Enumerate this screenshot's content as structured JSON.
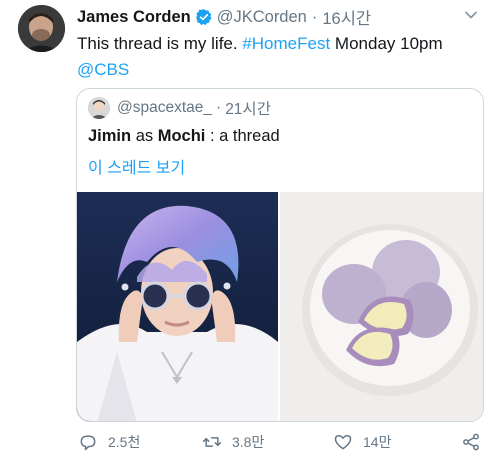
{
  "tweet": {
    "author_name": "James Corden",
    "author_handle": "@JKCorden",
    "separator": "·",
    "time": "16시간",
    "text_main": "This thread is my life. ",
    "hashtag": "#HomeFest",
    "text_after": " Monday 10pm",
    "mention": "@CBS"
  },
  "quote": {
    "handle": "@spacextae_",
    "separator": "·",
    "time": "21시간",
    "subject": "Jimin",
    "word_as": " as ",
    "object": "Mochi",
    "rest": " : a thread",
    "show_thread": "이 스레드 보기"
  },
  "actions": {
    "replies": "2.5천",
    "retweets": "3.8만",
    "likes": "14만"
  },
  "colors": {
    "link": "#1da1f2",
    "muted": "#657786",
    "text": "#14171a",
    "border": "#ccd6dd"
  },
  "icons": [
    "verified-badge-icon",
    "chevron-down-icon",
    "reply-icon",
    "retweet-icon",
    "like-icon",
    "share-icon"
  ]
}
